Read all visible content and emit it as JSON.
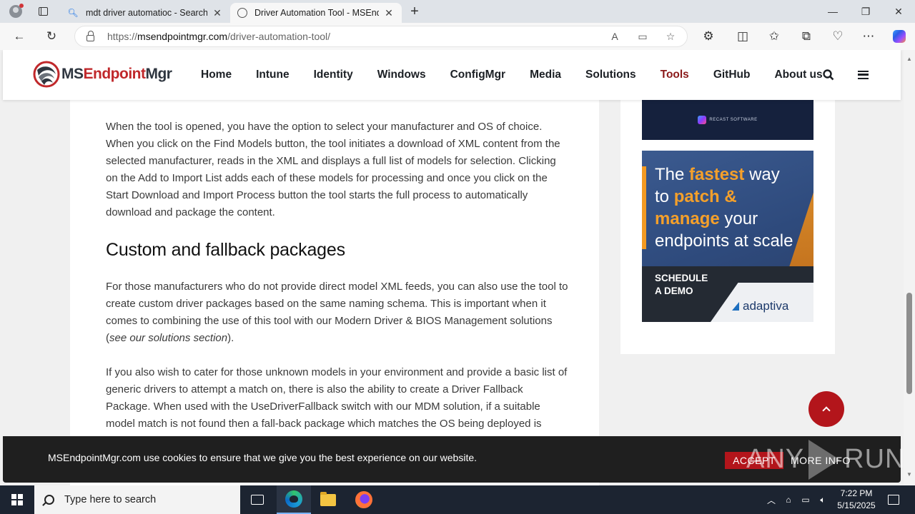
{
  "browser": {
    "tabs": [
      {
        "title": "mdt driver automatioc - Search",
        "active": false
      },
      {
        "title": "Driver Automation Tool - MSEndpointMgr",
        "active": true
      }
    ],
    "url_scheme": "https://",
    "url_host": "msendpointmgr.com",
    "url_path": "/driver-automation-tool/"
  },
  "site": {
    "logo_left": "MS",
    "logo_accent": "Endpoint",
    "logo_right": "Mgr",
    "nav": [
      "Home",
      "Intune",
      "Identity",
      "Windows",
      "ConfigMgr",
      "Media",
      "Solutions",
      "Tools",
      "GitHub",
      "About us"
    ],
    "current_nav": "Tools",
    "accent_color": "#b3151b"
  },
  "article": {
    "p1": "When the tool is opened, you have the option to select your manufacturer and OS of choice. When you click on the Find Models button, the tool initiates a download of XML content from the selected manufacturer, reads in the XML and displays a full list of models for selection. Clicking on the Add to Import List adds each of these models for processing and once you click on the Start Download and Import Process button the tool starts the full process to automatically download and package the content.",
    "h2": "Custom and fallback packages",
    "p2_main": "For those manufacturers who do not provide direct model XML feeds, you can also use the tool to create custom driver packages based on the same naming schema. This is important when it comes to combining the use of this tool with our Modern Driver & BIOS Management solutions (",
    "p2_em": "see our solutions section",
    "p2_end": ").",
    "p3": "If you also wish to cater for those unknown models in your environment and provide a basic list of generic drivers to attempt a match on, there is also the ability to create a Driver Fallback Package. When used with the UseDriverFallback switch with our MDM solution, if a suitable model match is not found then a fall-back package which matches the OS being deployed is"
  },
  "ads": {
    "ad1_brand": "RECAST SOFTWARE",
    "ad2_line1_a": "The ",
    "ad2_line1_hl": "fastest",
    "ad2_line1_b": " way",
    "ad2_line2_a": "to ",
    "ad2_line2_hl": "patch &",
    "ad2_line3_hl": "manage",
    "ad2_line3_b": " your",
    "ad2_line4": "endpoints at scale",
    "ad2_cta_1": "SCHEDULE",
    "ad2_cta_2": "A DEMO",
    "ad2_brand": "adaptiva"
  },
  "cookie": {
    "message": "MSEndpointMgr.com use cookies to ensure that we give you the best experience on our website.",
    "accept": "ACCEPT",
    "more": "MORE INFO"
  },
  "watermark": {
    "left": "ANY",
    "right": "RUN"
  },
  "taskbar": {
    "search_placeholder": "Type here to search",
    "time": "7:22 PM",
    "date": "5/15/2025"
  }
}
